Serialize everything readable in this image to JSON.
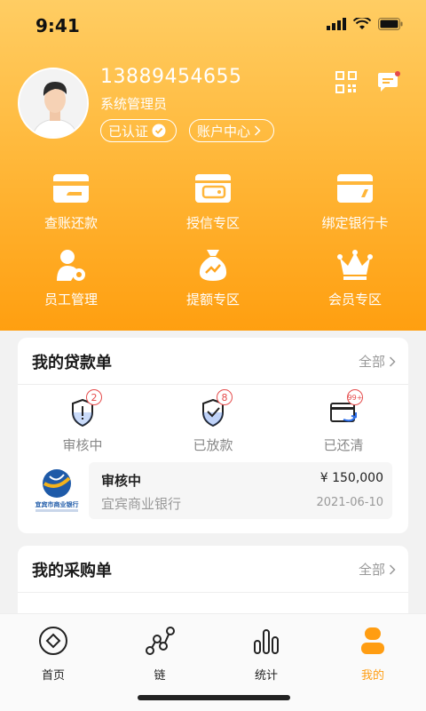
{
  "status_bar": {
    "time": "9:41"
  },
  "profile": {
    "phone": "13889454655",
    "role": "系统管理员",
    "verified_label": "已认证",
    "account_center_label": "账户中心"
  },
  "features": [
    {
      "label": "查账还款",
      "icon": "wallet-card-icon"
    },
    {
      "label": "授信专区",
      "icon": "wallet-icon"
    },
    {
      "label": "绑定银行卡",
      "icon": "bank-card-icon"
    },
    {
      "label": "员工管理",
      "icon": "staff-gear-icon"
    },
    {
      "label": "提额专区",
      "icon": "money-bag-icon"
    },
    {
      "label": "会员专区",
      "icon": "crown-icon"
    }
  ],
  "loan_card": {
    "title": "我的贷款单",
    "more_label": "全部",
    "statuses": [
      {
        "label": "审核中",
        "badge": "2"
      },
      {
        "label": "已放款",
        "badge": "8"
      },
      {
        "label": "已还清",
        "badge": "99+"
      }
    ],
    "item": {
      "status": "审核中",
      "bank": "宜宾商业银行",
      "amount": "¥ 150,000",
      "date": "2021-06-10",
      "logo_text": "宜宾市商业银行"
    }
  },
  "purchase_card": {
    "title": "我的采购单",
    "more_label": "全部"
  },
  "tabbar": [
    {
      "label": "首页",
      "icon": "home-icon"
    },
    {
      "label": "链",
      "icon": "chain-icon"
    },
    {
      "label": "统计",
      "icon": "stats-icon"
    },
    {
      "label": "我的",
      "icon": "profile-icon",
      "active": true
    }
  ],
  "colors": {
    "accent": "#ff9d12",
    "header_top": "#ffcd63",
    "badge": "#e54b4b"
  }
}
